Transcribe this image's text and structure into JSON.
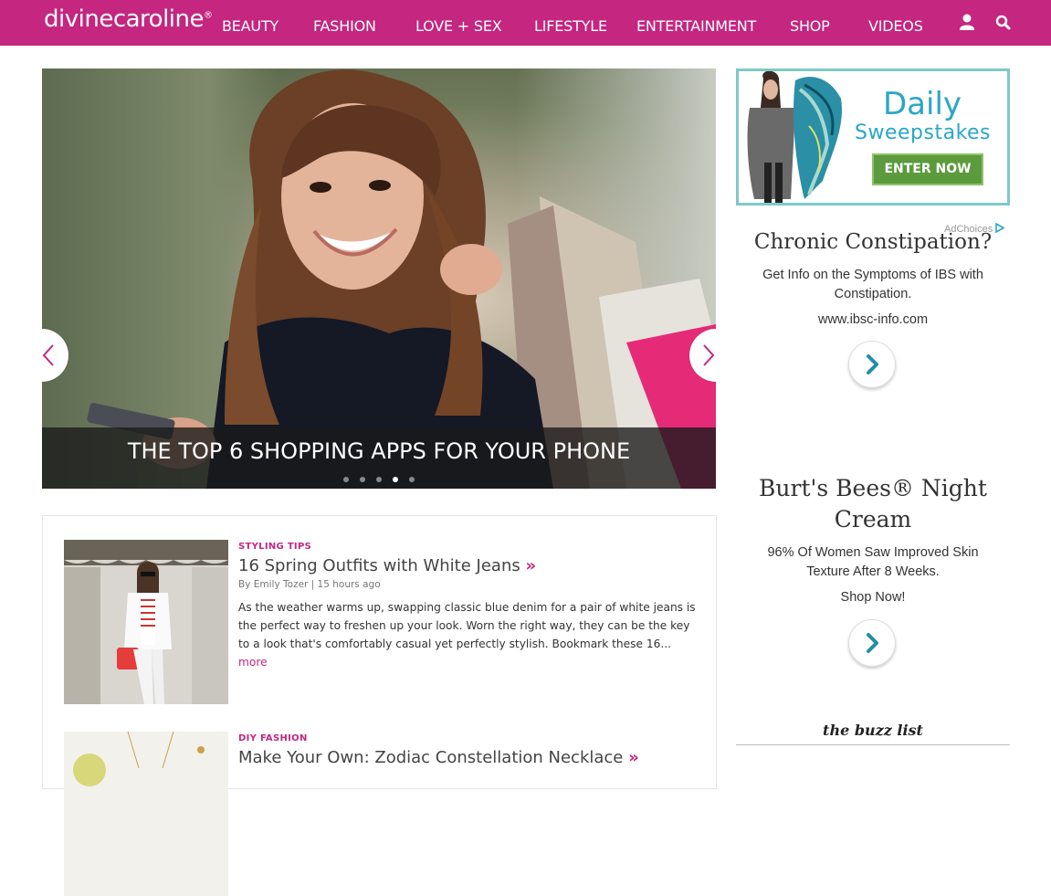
{
  "nav": {
    "logo": "divinecaroline",
    "logo_mark": "®",
    "items": [
      "BEAUTY",
      "FASHION",
      "LOVE + SEX",
      "LIFESTYLE",
      "ENTERTAINMENT",
      "SHOP",
      "VIDEOS"
    ],
    "user_icon": "user-icon",
    "search_icon": "search-icon"
  },
  "hero": {
    "caption": "THE TOP 6 SHOPPING APPS FOR YOUR PHONE",
    "slide_count": 5,
    "active_slide": 4,
    "prev_icon": "chevron-left-icon",
    "next_icon": "chevron-right-icon"
  },
  "feed": {
    "articles": [
      {
        "category": "STYLING TIPS",
        "title": "16 Spring Outfits with White Jeans",
        "raquo": "»",
        "byline": "By Emily Tozer | 15 hours ago",
        "excerpt": "As the weather warms up, swapping classic blue denim for a pair of white jeans is the perfect way to freshen up your look. Worn the right way, they can be the key to a look that's comfortably casual yet perfectly stylish. Bookmark these 16...",
        "more": "more"
      },
      {
        "category": "DIY FASHION",
        "title": "Make Your Own: Zodiac Constellation Necklace",
        "raquo": "»"
      }
    ]
  },
  "sidebar": {
    "sweepstakes": {
      "line1": "Daily",
      "line2": "Sweepstakes",
      "button": "ENTER NOW"
    },
    "adchoices": "AdChoices",
    "ads": [
      {
        "headline": "Chronic Constipation?",
        "body": "Get Info on the Symptoms of IBS with Constipation.",
        "url": "www.ibsc-info.com"
      },
      {
        "headline": "Burt's Bees® Night Cream",
        "body": "96% Of Women Saw Improved Skin Texture After 8 Weeks.",
        "url": "Shop Now!"
      }
    ],
    "buzz_title": "the buzz list"
  },
  "colors": {
    "brand": "#c42680",
    "teal": "#2aa6c6",
    "enter_green": "#5b9a3d"
  }
}
